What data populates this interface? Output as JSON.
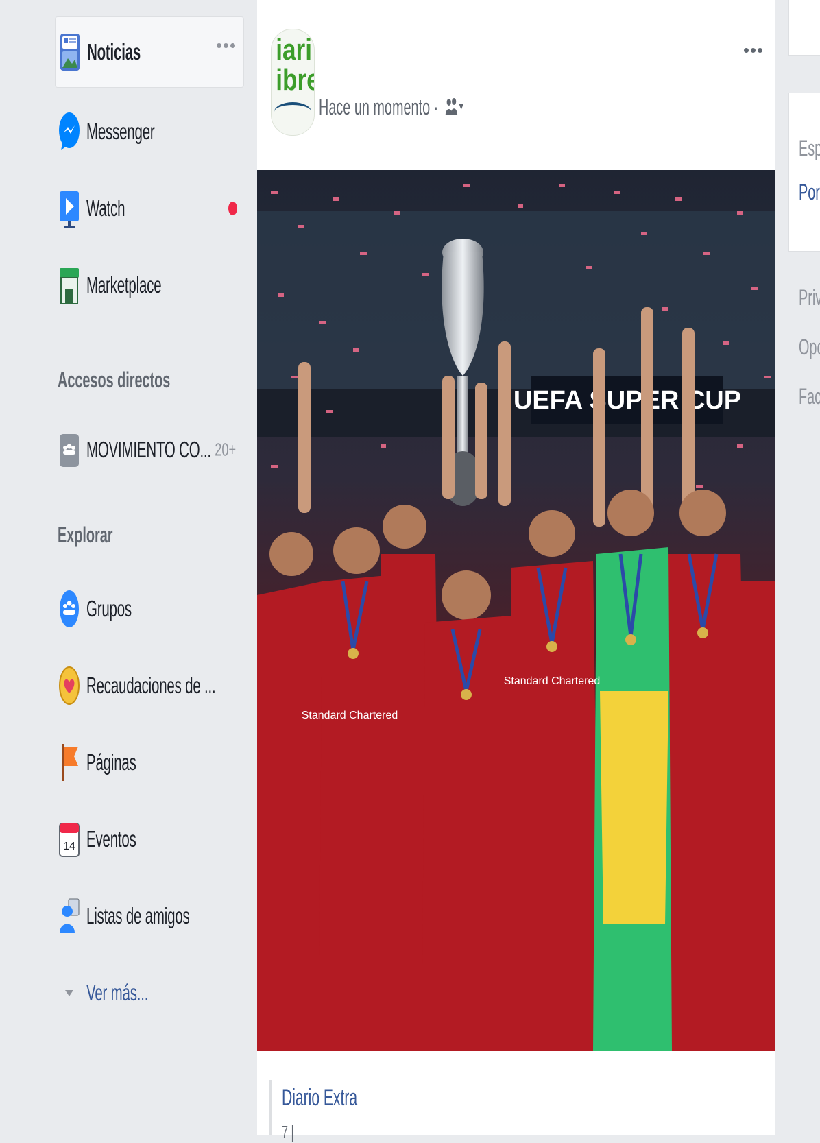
{
  "sidebar": {
    "items": [
      {
        "label": "Noticias",
        "icon": "news-feed-icon"
      },
      {
        "label": "Messenger",
        "icon": "messenger-icon"
      },
      {
        "label": "Watch",
        "icon": "watch-icon"
      },
      {
        "label": "Marketplace",
        "icon": "marketplace-icon"
      }
    ],
    "shortcuts_title": "Accesos directos",
    "shortcuts": [
      {
        "label": "MOVIMIENTO CO...",
        "count": "20+",
        "icon": "group-icon"
      }
    ],
    "explore_title": "Explorar",
    "explore": [
      {
        "label": "Grupos",
        "icon": "groups-icon"
      },
      {
        "label": "Recaudaciones de ...",
        "icon": "fundraiser-icon"
      },
      {
        "label": "Páginas",
        "icon": "pages-flag-icon"
      },
      {
        "label": "Eventos",
        "icon": "events-calendar-icon",
        "day": "14"
      },
      {
        "label": "Listas de amigos",
        "icon": "friend-lists-icon"
      }
    ],
    "see_more": "Ver más..."
  },
  "post": {
    "avatar_text": "iari\nibre",
    "time": "Hace un momento ·",
    "image": {
      "banner": "UEFA SUPER CUP",
      "sponsor": "Standard Chartered"
    },
    "source_name": "Diario Extra",
    "source_sub": "7 |"
  },
  "right": {
    "line1": "Esp",
    "line2": "Por",
    "line3": "Priv",
    "line4": "Opc",
    "line5": "Fac"
  },
  "colors": {
    "background": "#e9ebee",
    "link": "#365899",
    "notification": "#f02849",
    "jersey": "#b31b23"
  }
}
